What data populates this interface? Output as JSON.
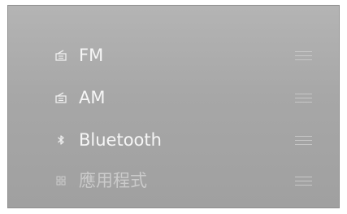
{
  "sources": [
    {
      "label": "FM",
      "icon": "radio-icon",
      "enabled": true
    },
    {
      "label": "AM",
      "icon": "radio-icon",
      "enabled": true
    },
    {
      "label": "Bluetooth",
      "icon": "bluetooth-icon",
      "enabled": true
    },
    {
      "label": "應用程式",
      "icon": "apps-grid-icon",
      "enabled": false
    }
  ],
  "colors": {
    "background": "#a8a8a8",
    "text": "#f6f6f6",
    "text_disabled": "#cbcbcb",
    "handle": "#c8c8c8"
  }
}
